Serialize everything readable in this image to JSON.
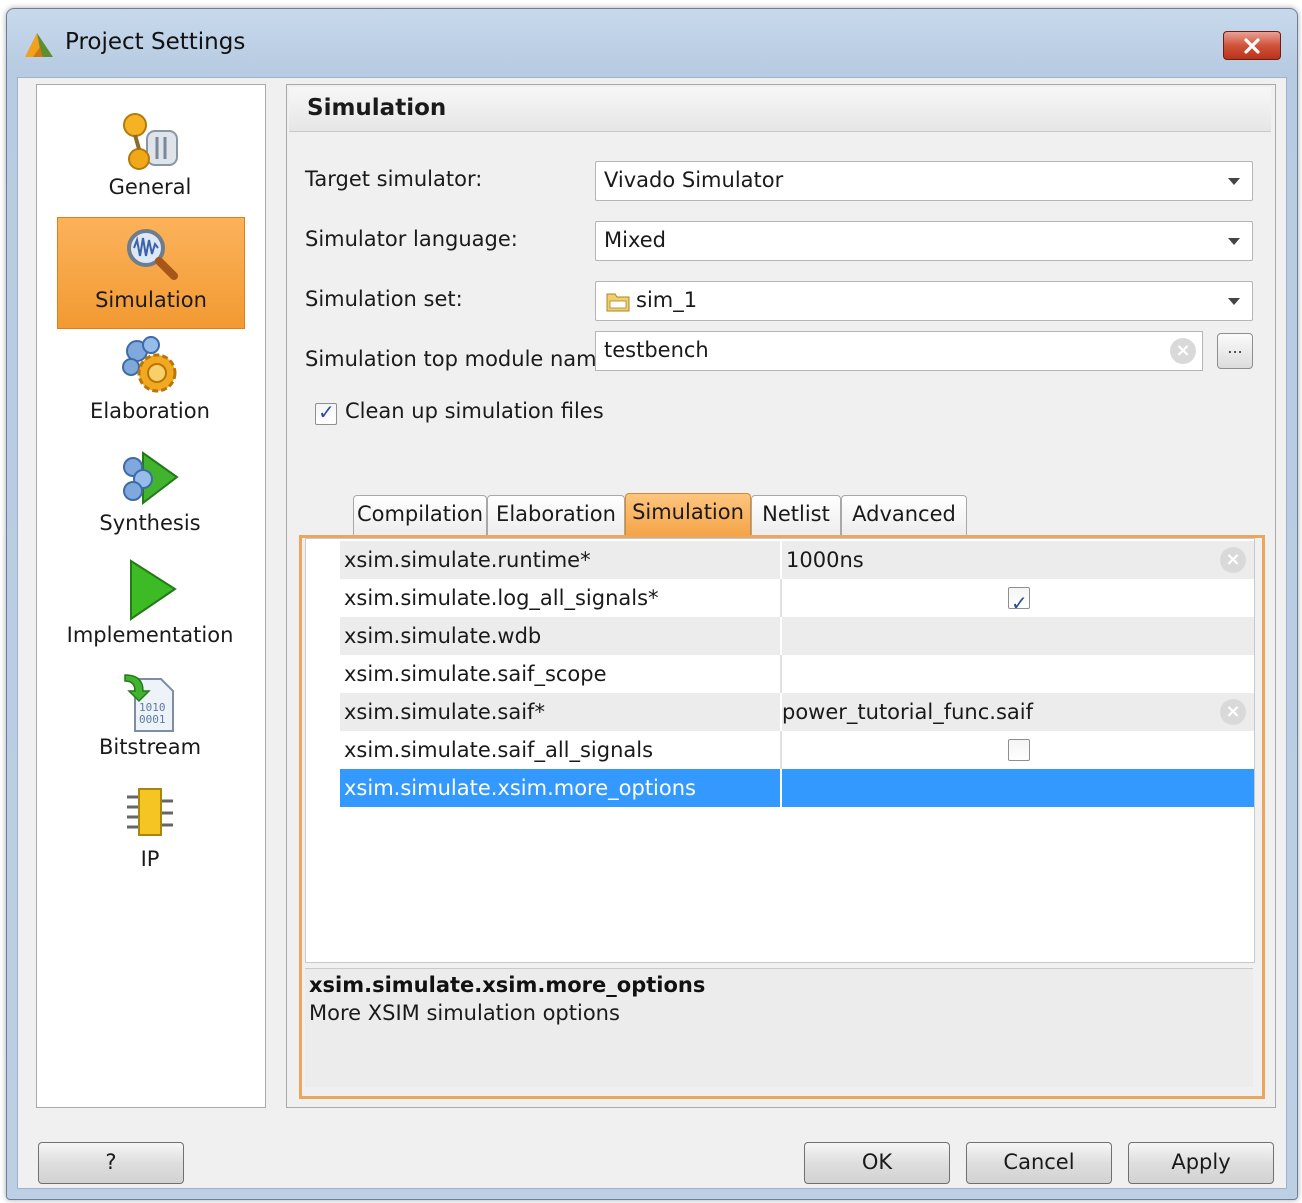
{
  "window": {
    "title": "Project Settings",
    "icons": {
      "app": "vivado-logo-icon",
      "close": "close-icon"
    }
  },
  "sidebar": {
    "items": [
      {
        "label": "General",
        "icon": "general-settings-icon",
        "selected": false
      },
      {
        "label": "Simulation",
        "icon": "simulation-magnifier-icon",
        "selected": true
      },
      {
        "label": "Elaboration",
        "icon": "elaboration-gear-icon",
        "selected": false
      },
      {
        "label": "Synthesis",
        "icon": "synthesis-icon",
        "selected": false
      },
      {
        "label": "Implementation",
        "icon": "implementation-play-icon",
        "selected": false
      },
      {
        "label": "Bitstream",
        "icon": "bitstream-file-icon",
        "selected": false
      },
      {
        "label": "IP",
        "icon": "ip-chip-icon",
        "selected": false
      }
    ]
  },
  "panel": {
    "title": "Simulation",
    "fields": {
      "target_simulator": {
        "label": "Target simulator:",
        "value": "Vivado Simulator"
      },
      "simulator_language": {
        "label": "Simulator language:",
        "value": "Mixed"
      },
      "simulation_set": {
        "label": "Simulation set:",
        "value": "sim_1"
      },
      "top_module": {
        "label": "Simulation top module name:",
        "value": "testbench",
        "browse": "..."
      }
    },
    "cleanup": {
      "label": "Clean up simulation files",
      "checked": true
    }
  },
  "tabs": [
    {
      "label": "Compilation",
      "active": false
    },
    {
      "label": "Elaboration",
      "active": false
    },
    {
      "label": "Simulation",
      "active": true
    },
    {
      "label": "Netlist",
      "active": false
    },
    {
      "label": "Advanced",
      "active": false
    }
  ],
  "properties": [
    {
      "name": "xsim.simulate.runtime*",
      "value": "1000ns",
      "type": "text"
    },
    {
      "name": "xsim.simulate.log_all_signals*",
      "value": "",
      "type": "checkbox",
      "checked": true
    },
    {
      "name": "xsim.simulate.wdb",
      "value": "",
      "type": "text"
    },
    {
      "name": "xsim.simulate.saif_scope",
      "value": "",
      "type": "text"
    },
    {
      "name": "xsim.simulate.saif*",
      "value": "power_tutorial_func.saif",
      "type": "text"
    },
    {
      "name": "xsim.simulate.saif_all_signals",
      "value": "",
      "type": "checkbox",
      "checked": false
    },
    {
      "name": "xsim.simulate.xsim.more_options",
      "value": "",
      "type": "text",
      "selected": true
    }
  ],
  "description": {
    "title": "xsim.simulate.xsim.more_options",
    "text": "More XSIM simulation options"
  },
  "buttons": {
    "help": "?",
    "ok": "OK",
    "cancel": "Cancel",
    "apply": "Apply"
  },
  "colors": {
    "selection_orange": "#f4a447",
    "row_selected_blue": "#3399ff",
    "title_bar_blue": "#c8d9ec"
  }
}
